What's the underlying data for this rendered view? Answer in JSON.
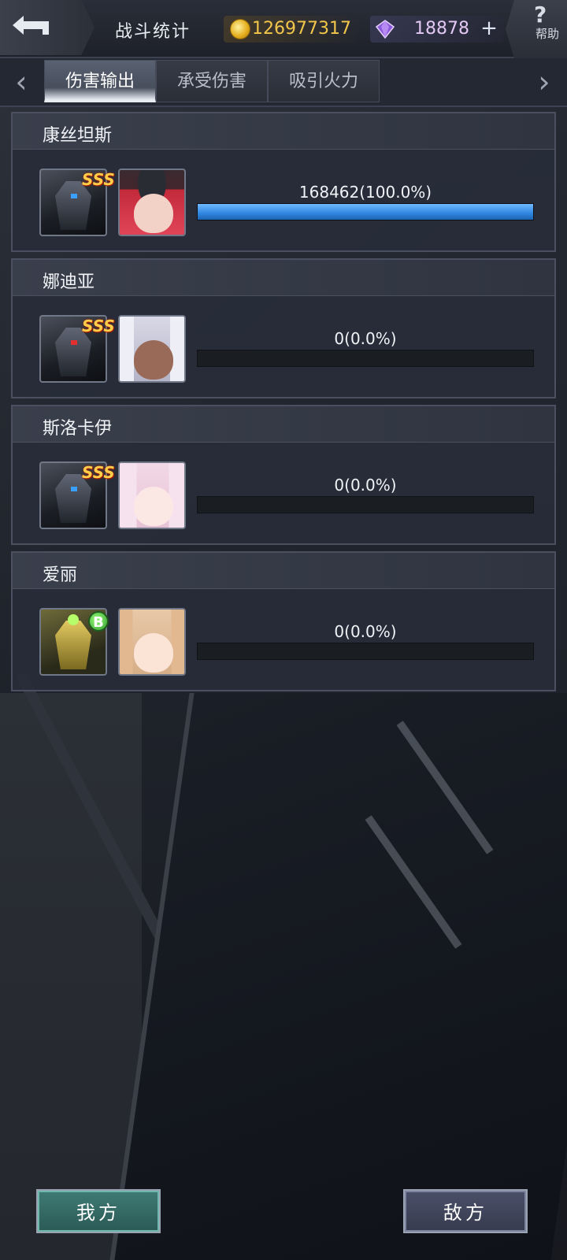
{
  "header": {
    "title": "战斗统计",
    "gold": "126977317",
    "gems": "18878",
    "plus_label": "+",
    "help_symbol": "?",
    "help_label": "帮助"
  },
  "tabs": [
    {
      "label": "伤害输出",
      "active": true
    },
    {
      "label": "承受伤害",
      "active": false
    },
    {
      "label": "吸引火力",
      "active": false
    }
  ],
  "tab_arrows": {
    "left": "‹",
    "right": "›"
  },
  "stats": [
    {
      "name": "康丝坦斯",
      "rank": "SSS",
      "stat_text": "168462(100.0%)",
      "percent": 100.0,
      "mech_icon": "mech-dark-icon",
      "portrait_icon": "red-hair-captain-portrait"
    },
    {
      "name": "娜迪亚",
      "rank": "SSS",
      "stat_text": "0(0.0%)",
      "percent": 0.0,
      "mech_icon": "mech-red-icon",
      "portrait_icon": "white-hair-portrait"
    },
    {
      "name": "斯洛卡伊",
      "rank": "SSS",
      "stat_text": "0(0.0%)",
      "percent": 0.0,
      "mech_icon": "mech-black-icon",
      "portrait_icon": "pink-hair-portrait"
    },
    {
      "name": "爱丽",
      "rank": "B",
      "stat_text": "0(0.0%)",
      "percent": 0.0,
      "mech_icon": "mech-gold-icon",
      "portrait_icon": "blonde-hair-portrait"
    }
  ],
  "footer": {
    "mine_label": "我方",
    "enemy_label": "敌方"
  },
  "colors": {
    "bar_fill": "#2f86e0",
    "gold_text": "#f2c64a",
    "gem_text": "#e2c8f2"
  }
}
